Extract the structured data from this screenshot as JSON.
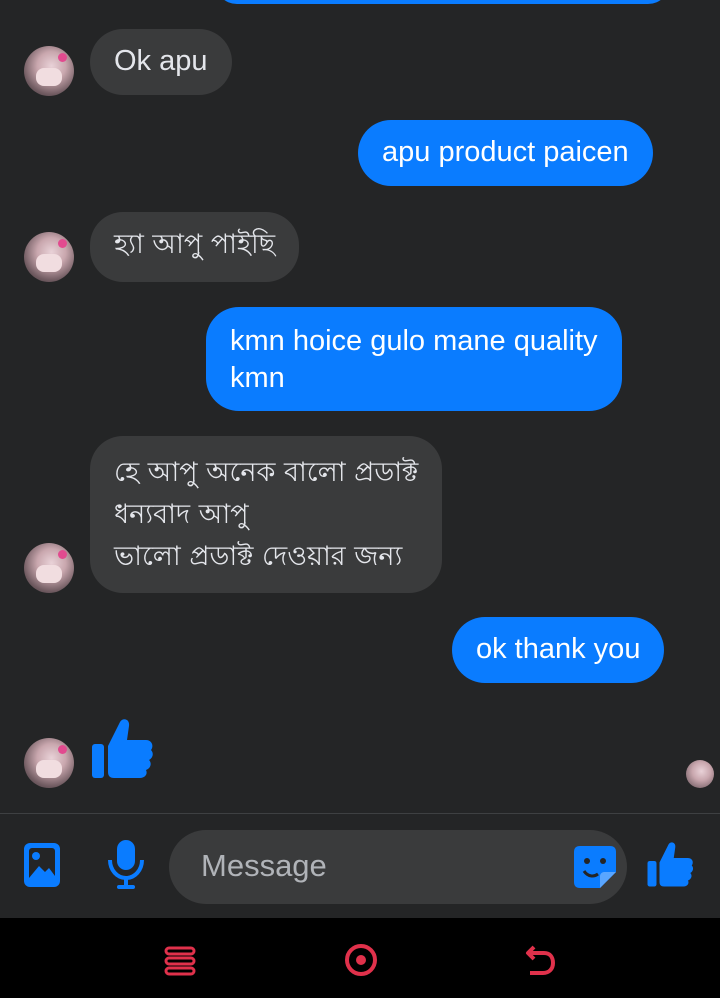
{
  "conversation": {
    "messages": [
      {
        "side": "in",
        "text": "Ok apu"
      },
      {
        "side": "out",
        "text": "apu product paicen"
      },
      {
        "side": "in",
        "text": "হ্যা আপু পাইছি"
      },
      {
        "side": "out",
        "lines": [
          "kmn hoice gulo mane quality",
          "kmn"
        ]
      },
      {
        "side": "in",
        "lines": [
          "হে আপু অনেক বালো প্রডাক্ট",
          "ধন্যবাদ আপু",
          "ভালো প্রডাক্ট দেওয়ার জন্য"
        ]
      },
      {
        "side": "out",
        "text": "ok thank you"
      }
    ]
  },
  "composer": {
    "placeholder": "Message"
  },
  "colors": {
    "background": "#242526",
    "incoming_bubble": "#3a3b3c",
    "outgoing_bubble": "#0a7cff",
    "accent": "#0a7cff",
    "navbar_accent": "#e0314b"
  },
  "icons": {
    "gallery": "image-icon",
    "mic": "microphone-icon",
    "sticker": "sticker-icon",
    "like": "thumbs-up-icon",
    "nav_recents": "recents-icon",
    "nav_home": "home-icon",
    "nav_back": "back-icon"
  }
}
